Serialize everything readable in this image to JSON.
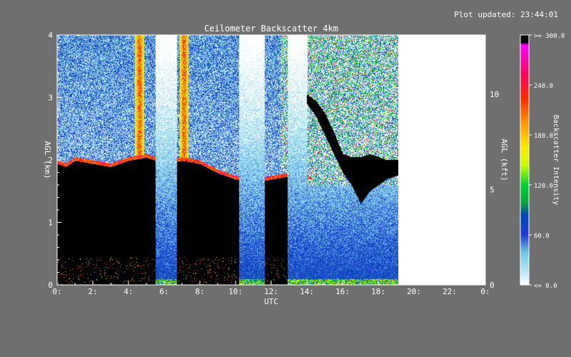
{
  "header": {
    "updated": "Plot updated: 23:44:01"
  },
  "chart_data": {
    "type": "heatmap",
    "title": "Ceilometer Backscatter 4km",
    "xlabel": "UTC",
    "ylabel_left": "AGL (km)",
    "ylabel_right": "AGL (kft)",
    "colorbar_label": "Backscatter Intensity",
    "x_range_hours": [
      0,
      24
    ],
    "data_end_hour": 19.1,
    "y_range_km": [
      0,
      4
    ],
    "y_range_kft": [
      0,
      13.12
    ],
    "x_ticks": [
      "0:",
      "2:",
      "4:",
      "6:",
      "8:",
      "10:",
      "12:",
      "14:",
      "16:",
      "18:",
      "20:",
      "22:",
      "0:"
    ],
    "y_ticks_left": [
      "0",
      "1",
      "2",
      "3",
      "4"
    ],
    "y_ticks_right": [
      "0",
      "5",
      "10"
    ],
    "colorbar_ticks": [
      "<=   0.0",
      "60.0",
      "120.0",
      "180.0",
      "240.0",
      ">= 300.0"
    ],
    "colorbar_range": [
      0,
      300
    ],
    "colors": {
      "background": "#6f6f6f",
      "plot_empty": "#ffffff",
      "cloud": "#000000",
      "low": "#b9e6f5",
      "mid": "#1e3cd2",
      "high": "#ff00ff"
    },
    "cloud_layer_top_km": [
      [
        0.0,
        2.0
      ],
      [
        0.5,
        1.95
      ],
      [
        1.0,
        2.05
      ],
      [
        2.0,
        2.0
      ],
      [
        3.0,
        1.95
      ],
      [
        4.0,
        2.05
      ],
      [
        5.0,
        2.1
      ],
      [
        6.0,
        2.0
      ],
      [
        7.0,
        2.05
      ],
      [
        8.0,
        2.0
      ],
      [
        9.0,
        1.85
      ],
      [
        10.0,
        1.75
      ],
      [
        11.0,
        1.7
      ],
      [
        12.0,
        1.75
      ],
      [
        13.0,
        1.8
      ],
      [
        13.5,
        1.9
      ],
      [
        14.3,
        1.7
      ],
      [
        15.0,
        1.65
      ]
    ],
    "late_cloud_base_km": [
      [
        14.0,
        2.9
      ],
      [
        14.5,
        2.7
      ],
      [
        15.0,
        2.4
      ],
      [
        15.5,
        2.1
      ],
      [
        16.0,
        1.8
      ],
      [
        16.5,
        1.6
      ],
      [
        17.0,
        1.3
      ],
      [
        17.5,
        1.5
      ],
      [
        18.0,
        1.6
      ],
      [
        18.5,
        1.7
      ],
      [
        19.0,
        1.75
      ]
    ],
    "late_cloud_top_km": [
      [
        14.0,
        3.0
      ],
      [
        14.5,
        2.9
      ],
      [
        15.0,
        2.7
      ],
      [
        15.5,
        2.4
      ],
      [
        16.0,
        2.05
      ],
      [
        16.5,
        2.0
      ],
      [
        17.0,
        2.0
      ],
      [
        17.5,
        2.05
      ],
      [
        18.0,
        2.0
      ],
      [
        18.5,
        1.95
      ],
      [
        19.0,
        1.95
      ]
    ],
    "clear_gaps_hours": [
      [
        5.5,
        6.7
      ],
      [
        10.2,
        11.6
      ],
      [
        12.9,
        14.0
      ]
    ],
    "plumes_hours": [
      4.6,
      7.1
    ]
  }
}
